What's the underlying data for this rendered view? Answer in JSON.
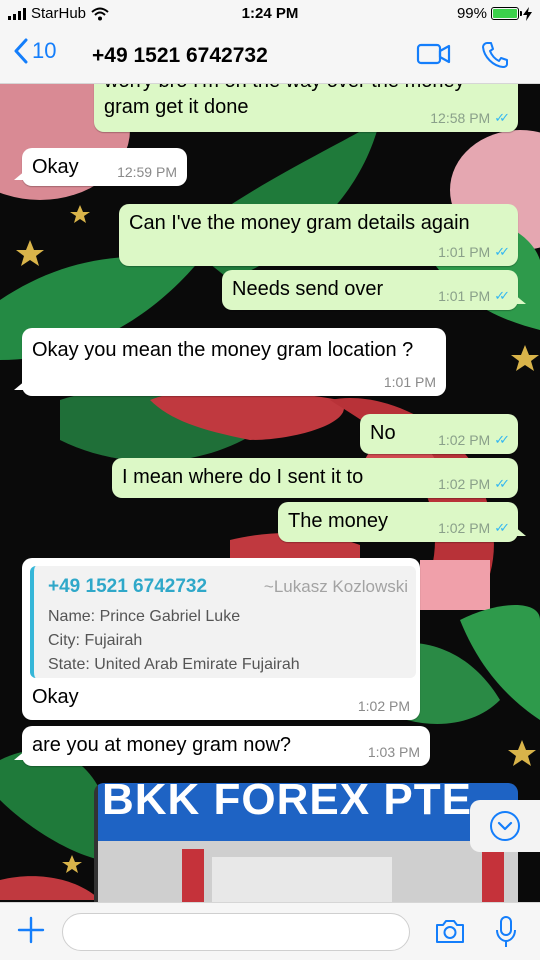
{
  "status_bar": {
    "carrier": "StarHub",
    "time": "1:24 PM",
    "battery_percent": "99%",
    "battery_level": 0.99
  },
  "header": {
    "back_count": "10",
    "contact": "+49 1521 6742732",
    "icons": [
      "chevron-left-icon",
      "video-call-icon",
      "phone-call-icon"
    ]
  },
  "messages": [
    {
      "dir": "out",
      "text": "worry bro I'm on the way over the money gram get it done",
      "time": "12:58 PM"
    },
    {
      "dir": "in",
      "text": "Okay",
      "time": "12:59 PM"
    },
    {
      "dir": "out",
      "text": "Can I've the money gram details again",
      "time": "1:01 PM"
    },
    {
      "dir": "out",
      "text": "Needs send over",
      "time": "1:01 PM"
    },
    {
      "dir": "in",
      "text": "Okay you mean the money gram location ?",
      "time": "1:01 PM"
    },
    {
      "dir": "out",
      "text": "No",
      "time": "1:02 PM"
    },
    {
      "dir": "out",
      "text": "I mean where do I sent it to",
      "time": "1:02 PM"
    },
    {
      "dir": "out",
      "text": "The money",
      "time": "1:02 PM"
    },
    {
      "dir": "in",
      "text": "Okay",
      "time": "1:02 PM",
      "quote": {
        "number": "+49 1521 6742732",
        "name": "~Lukasz Kozlowski",
        "lines": [
          "Name: Prince Gabriel Luke",
          "City: Fujairah",
          "State: United Arab Emirate Fujairah"
        ]
      }
    },
    {
      "dir": "in",
      "text": "are you at money gram now?",
      "time": "1:03 PM"
    }
  ],
  "photo": {
    "sign_text": "BKK FOREX PTE"
  },
  "input": {
    "placeholder": ""
  },
  "colors": {
    "accent": "#147efb",
    "bubble_out": "#dcf8c6",
    "bubble_in": "#ffffff",
    "read_ticks": "#34b7f1",
    "quote_bar": "#35b6d8"
  }
}
